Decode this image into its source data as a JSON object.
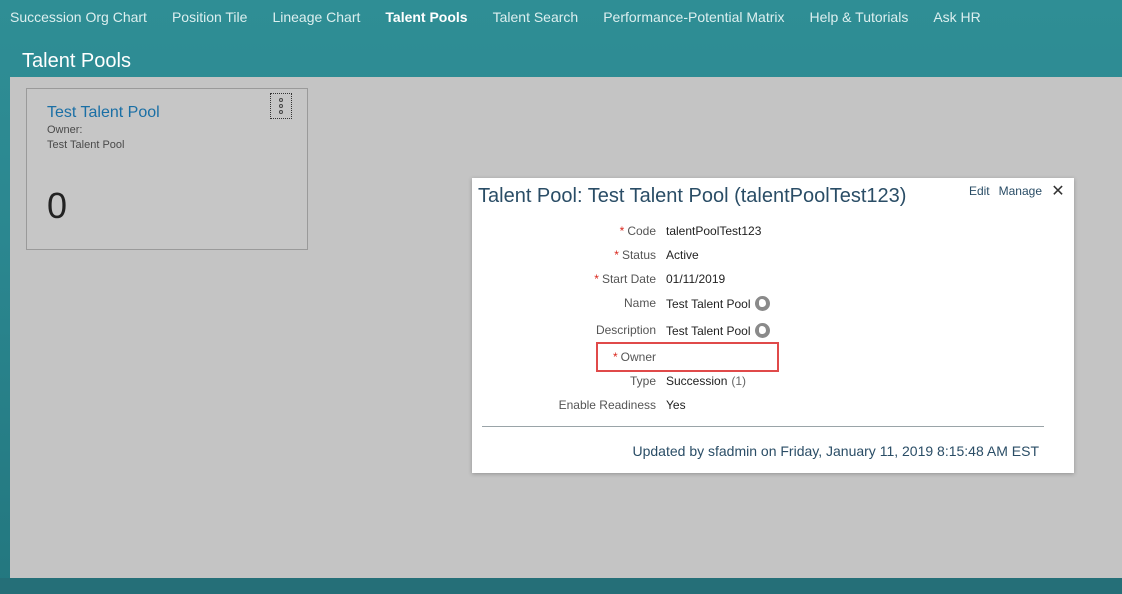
{
  "nav": {
    "items": [
      {
        "label": "Succession Org Chart"
      },
      {
        "label": "Position Tile"
      },
      {
        "label": "Lineage Chart"
      },
      {
        "label": "Talent Pools"
      },
      {
        "label": "Talent Search"
      },
      {
        "label": "Performance-Potential Matrix"
      },
      {
        "label": "Help & Tutorials"
      },
      {
        "label": "Ask HR"
      }
    ],
    "active_index": 3
  },
  "page": {
    "title": "Talent Pools"
  },
  "tile": {
    "title": "Test Talent Pool",
    "owner_label": "Owner:",
    "owner_value": "Test Talent Pool",
    "count": "0"
  },
  "dialog": {
    "title": "Talent Pool: Test Talent Pool (talentPoolTest123)",
    "edit_label": "Edit",
    "manage_label": "Manage",
    "close_glyph": "✕",
    "required_marker": "*",
    "fields": {
      "code": {
        "label": "Code",
        "value": "talentPoolTest123"
      },
      "status": {
        "label": "Status",
        "value": "Active"
      },
      "start_date": {
        "label": "Start Date",
        "value": "01/11/2019"
      },
      "name": {
        "label": "Name",
        "value": "Test Talent Pool"
      },
      "description": {
        "label": "Description",
        "value": "Test Talent Pool"
      },
      "owner": {
        "label": "Owner",
        "value": ""
      },
      "type": {
        "label": "Type",
        "value": "Succession",
        "count": "(1)"
      },
      "enable_readiness": {
        "label": "Enable Readiness",
        "value": "Yes"
      }
    },
    "updated_text": "Updated by sfadmin on Friday, January 11, 2019 8:15:48 AM EST"
  },
  "colors": {
    "header_teal": "#2b8790",
    "content_grey": "#c4c4c4",
    "link_blue": "#1a6fa5",
    "required_red": "#d9261c",
    "highlight_red": "#e04a4a"
  },
  "icons": [
    "more-options-icon",
    "globe-icon",
    "close-icon"
  ]
}
